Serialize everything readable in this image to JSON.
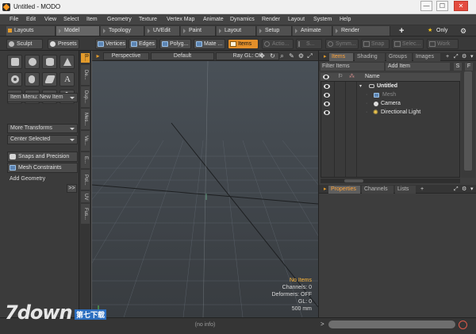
{
  "window": {
    "title": "Untitled - MODO",
    "min": "—",
    "max": "☐",
    "close": "✕"
  },
  "menu": [
    "File",
    "Edit",
    "View",
    "Select",
    "Item",
    "Geometry",
    "Texture",
    "Vertex Map",
    "Animate",
    "Dynamics",
    "Render",
    "Layout",
    "System",
    "Help"
  ],
  "layout_tabs": [
    "Layouts",
    "Model",
    "Topology",
    "UVEdit",
    "Paint",
    "Layout",
    "Setup",
    "Animate",
    "Render"
  ],
  "layout_tabs_active": "Model",
  "add_tab": "+",
  "only_label": "Only",
  "toolbar": {
    "sculpt": "Sculpt",
    "presets": "Presets",
    "vertices": "Vertices",
    "edges": "Edges",
    "polygons": "Polyg...",
    "materials": "Mate ...",
    "items": "Items",
    "action": "Actio...",
    "s_btn": "S...",
    "symmetry": "Symm...",
    "snap": "Snap",
    "select": "Selec...",
    "work": "Work"
  },
  "left": {
    "item_menu": "Item Menu: New Item",
    "more_transforms": "More Transforms",
    "center_selected": "Center Selected",
    "snaps": "Snaps and Precision",
    "mesh_constraints": "Mesh Constraints",
    "add_geometry": "Add Geometry",
    "expand": ">>",
    "vtabs": [
      "B...",
      "De...",
      "Dup...",
      "Mes...",
      "Ve...",
      "E...",
      "Pol...",
      "UV",
      "Fus..."
    ],
    "tool_icons": [
      "cube-icon",
      "sphere-icon",
      "cylinder-icon",
      "cone-icon",
      "torus-icon",
      "capsule-icon",
      "pen-icon",
      "text-icon",
      "curve-icon",
      "star-icon",
      "scale-icon",
      "rotate-icon",
      "move-icon"
    ]
  },
  "viewport": {
    "camera": "Perspective",
    "shading": "Default",
    "ray_gl": "Ray GL: Off",
    "info_lines": [
      "No Items",
      "Channels: 0",
      "Deformers: OFF",
      "GL: 0",
      "500 mm"
    ]
  },
  "right": {
    "tabs": [
      "Items",
      "Shading",
      "Groups",
      "Images"
    ],
    "filter_placeholder": "Filter Items",
    "add_item": "Add Item",
    "col_name": "Name",
    "items": [
      {
        "name": "Untitled",
        "style": "bold"
      },
      {
        "name": "Mesh",
        "style": "dim"
      },
      {
        "name": "Camera",
        "style": "normal"
      },
      {
        "name": "Directional Light",
        "style": "normal"
      }
    ],
    "props_tabs": [
      "Properties",
      "Channels",
      "Lists"
    ]
  },
  "status": {
    "no_info": "(no info)"
  },
  "colors": {
    "accent": "#e39b2c",
    "panel": "#3b3b3b",
    "viewport": "#454b51"
  },
  "watermark": {
    "text": "7down",
    "sub": "第七下载"
  }
}
